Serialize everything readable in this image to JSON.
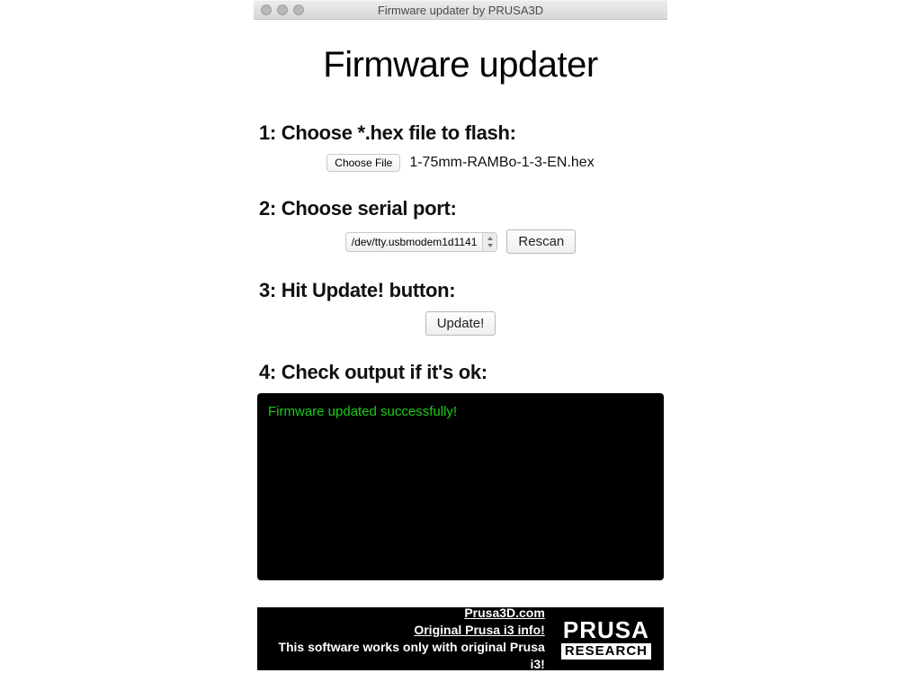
{
  "window": {
    "title": "Firmware updater by PRUSA3D"
  },
  "page": {
    "title": "Firmware updater"
  },
  "step1": {
    "label": "1: Choose *.hex file to flash:",
    "choose_button": "Choose File",
    "filename": "1-75mm-RAMBo-1-3-EN.hex"
  },
  "step2": {
    "label": "2: Choose serial port:",
    "port_value": "/dev/tty.usbmodem1d1141",
    "rescan": "Rescan"
  },
  "step3": {
    "label": "3: Hit Update! button:",
    "update": "Update!"
  },
  "step4": {
    "label": "4: Check output if it's ok:",
    "console_line": "Firmware updated successfully!"
  },
  "footer": {
    "link1": "Prusa3D.com",
    "link2": "Original Prusa i3 info!",
    "note": "This software works only with original Prusa i3!",
    "logo_top": "PRUSA",
    "logo_bottom": "RESEARCH"
  }
}
